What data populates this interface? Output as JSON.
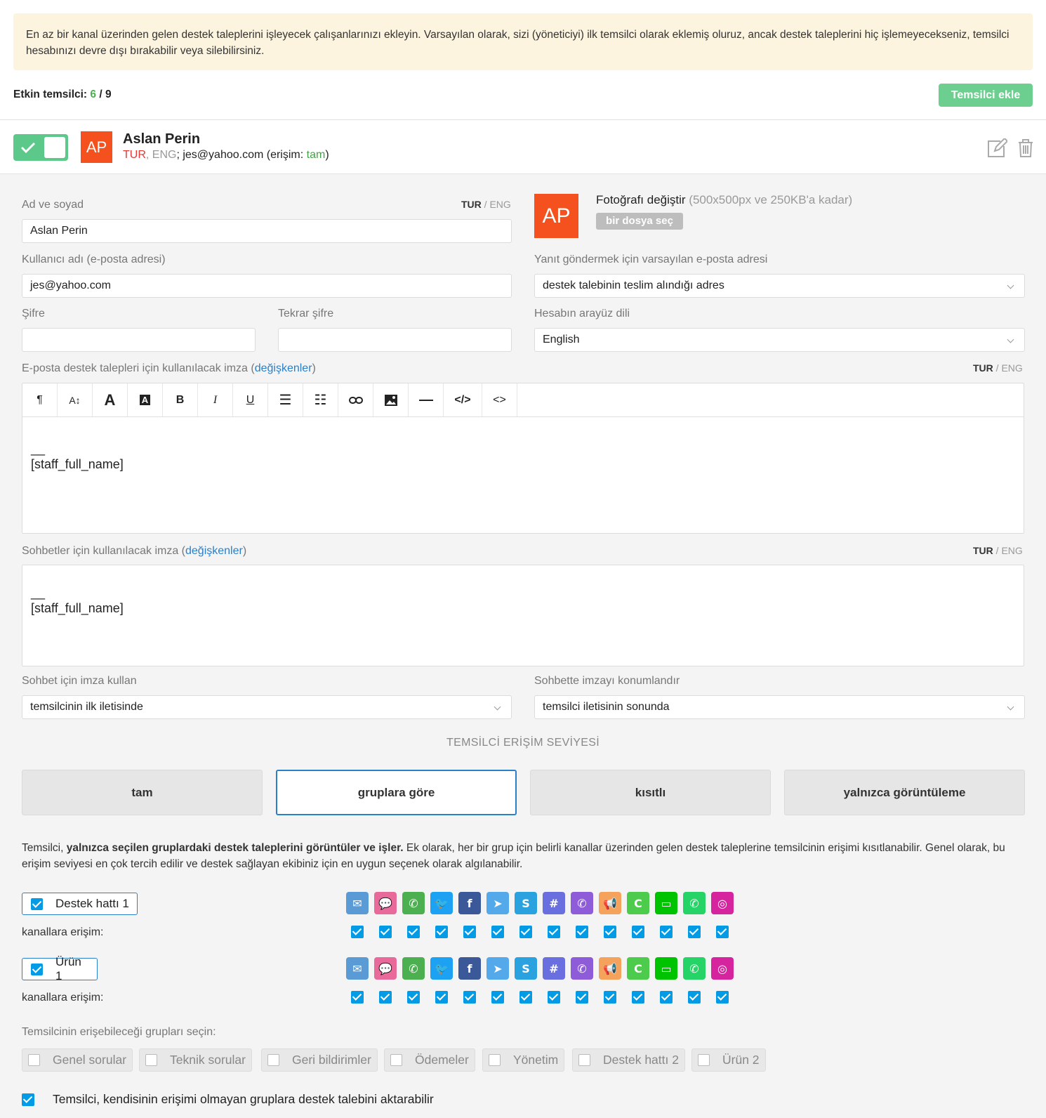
{
  "notice": "En az bir kanal üzerinden gelen destek taleplerini işleyecek çalışanlarınızı ekleyin. Varsayılan olarak, sizi (yöneticiyi) ilk temsilci olarak eklemiş oluruz, ancak destek taleplerini hiç işlemeyecekseniz, temsilci hesabınızı devre dışı bırakabilir veya silebilirsiniz.",
  "active": {
    "label": "Etkin temsilci:",
    "current": "6",
    "sep": " / ",
    "total": "9"
  },
  "add_button": "Temsilci ekle",
  "agent": {
    "initials": "AP",
    "name": "Aslan Perin",
    "lang1": "TUR",
    "comma": ", ",
    "lang2": "ENG",
    "email_part": "; jes@yahoo.com (erişim: ",
    "access": "tam",
    "close": ")"
  },
  "form": {
    "name_label": "Ad ve soyad",
    "lang_tur": "TUR",
    "lang_sep": " / ",
    "lang_eng": "ENG",
    "name_value": "Aslan Perin",
    "username_label": "Kullanıcı adı (e-posta adresi)",
    "username_value": "jes@yahoo.com",
    "password_label": "Şifre",
    "password_repeat_label": "Tekrar şifre",
    "photo_title": "Fotoğrafı değiştir",
    "photo_hint": " (500x500px ve 250KB'a kadar)",
    "file_button": "bir dosya seç",
    "reply_email_label": "Yanıt göndermek için varsayılan e-posta adresi",
    "reply_email_value": "destek talebinin teslim alındığı adres",
    "ui_lang_label": "Hesabın arayüz dili",
    "ui_lang_value": "English",
    "email_sig_label": "E-posta destek talepleri için kullanılacak imza (",
    "variables": "değişkenler",
    "paren_close": ")",
    "sig_dash": "__",
    "sig_var": "[staff_full_name]",
    "chat_sig_label": "Sohbetler için kullanılacak imza (",
    "use_sig_label": "Sohbet için imza kullan",
    "use_sig_value": "temsilcinin ilk iletisinde",
    "pos_sig_label": "Sohbette imzayı konumlandır",
    "pos_sig_value": "temsilci iletisinin sonunda"
  },
  "toolbar": [
    "paragraph-icon",
    "font-size-icon",
    "font-color-icon",
    "bg-color-icon",
    "bold-icon",
    "italic-icon",
    "underline-icon",
    "bulleted-list-icon",
    "numbered-list-icon",
    "link-icon",
    "image-icon",
    "horizontal-line-icon",
    "code-view-icon",
    "code-icon"
  ],
  "access_section": {
    "title": "TEMSİLCİ ERİŞİM SEVİYESİ",
    "levels": [
      "tam",
      "gruplara göre",
      "kısıtlı",
      "yalnızca görüntüleme"
    ],
    "active": "gruplara göre",
    "desc_start": "Temsilci, ",
    "desc_bold": "yalnızca seçilen gruplardaki destek taleplerini görüntüler ve işler.",
    "desc_end": " Ek olarak, her bir grup için belirli kanallar üzerinden gelen destek taleplerine temsilcinin erişimi kısıtlanabilir. Genel olarak, bu erişim seviyesi en çok tercih edilir ve destek sağlayan ekibiniz için en uygun seçenek olarak algılanabilir."
  },
  "groups": [
    {
      "name": "Destek hattı 1",
      "channels_label": "kanallara erişim:"
    },
    {
      "name": "Ürün 1",
      "channels_label": "kanallara erişim:"
    }
  ],
  "channels": [
    {
      "icon": "email-icon",
      "color": "#5b9bd5"
    },
    {
      "icon": "chat-icon",
      "color": "#e86a9a"
    },
    {
      "icon": "phone-icon",
      "color": "#4caf50"
    },
    {
      "icon": "twitter-icon",
      "color": "#1da1f2"
    },
    {
      "icon": "facebook-icon",
      "color": "#3b5998"
    },
    {
      "icon": "telegram-icon",
      "color": "#54a9eb"
    },
    {
      "icon": "skype-icon",
      "color": "#2aa2e0"
    },
    {
      "icon": "slack-icon",
      "color": "#6a6fe0"
    },
    {
      "icon": "viber-icon",
      "color": "#8e5cd9"
    },
    {
      "icon": "megaphone-icon",
      "color": "#f5a35c"
    },
    {
      "icon": "chatra-icon",
      "color": "#4ccb4c"
    },
    {
      "icon": "line-icon",
      "color": "#00c300"
    },
    {
      "icon": "whatsapp-icon",
      "color": "#25d366"
    },
    {
      "icon": "instagram-icon",
      "color": "#d6249f"
    }
  ],
  "choose_groups": {
    "label": "Temsilcinin erişebileceği grupları seçin:",
    "options": [
      "Genel sorular",
      "Teknik sorular",
      "Geri bildirimler",
      "Ödemeler",
      "Yönetim",
      "Destek hattı 2",
      "Ürün 2"
    ]
  },
  "transfer_label": "Temsilci, kendisinin erişimi olmayan gruplara destek talebini aktarabilir"
}
